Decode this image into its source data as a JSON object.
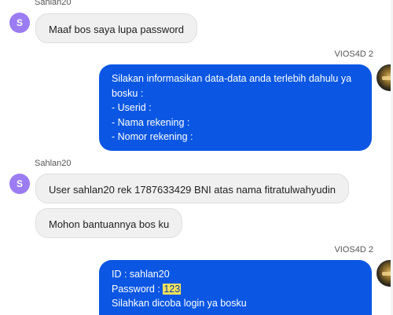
{
  "user": {
    "name": "Sahlan20",
    "avatar_letter": "S"
  },
  "agent": {
    "name": "VIOS4D 2"
  },
  "messages": {
    "m1": {
      "text": "Maaf bos saya lupa password"
    },
    "m2": {
      "lines": [
        "Silakan informasikan data-data anda terlebih dahulu ya",
        "bosku :",
        "- Userid :",
        "- Nama rekening :",
        "- Nomor rekening :"
      ]
    },
    "m3": {
      "text": "User sahlan20 rek 1787633429 BNI atas nama fitratulwahyudin"
    },
    "m4": {
      "text": "Mohon bantuannya bos ku"
    },
    "m5": {
      "id_line": "ID : sahlan20",
      "password_label": "Password : ",
      "password_value": "123",
      "last_line": "Silahkan dicoba login ya bosku"
    }
  },
  "colors": {
    "outgoing_bubble": "#0b57e3",
    "incoming_bubble": "#f0f0f0",
    "user_avatar": "#9b7cf2",
    "highlight": "#f7e35a"
  }
}
